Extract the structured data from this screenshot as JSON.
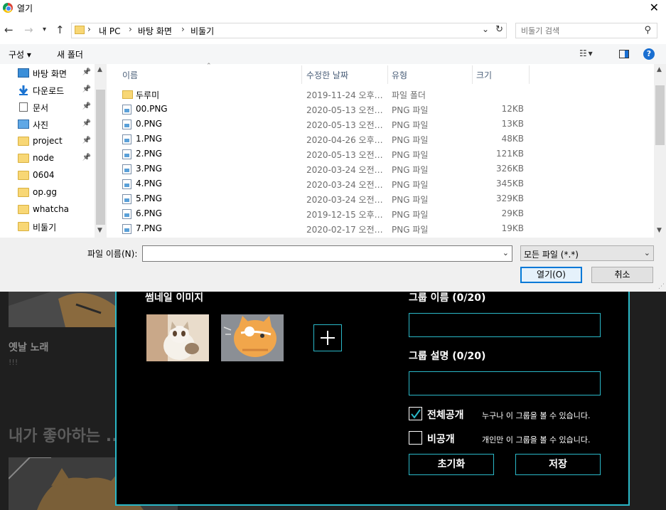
{
  "dialog": {
    "title": "열기",
    "address": {
      "root": "내 PC",
      "parts": [
        "바탕 화면",
        "비둘기"
      ]
    },
    "search_placeholder": "비둘기 검색",
    "toolbar": {
      "organize": "구성 ▾",
      "new_folder": "새 폴더",
      "help": "?"
    },
    "nav_items": [
      {
        "label": "바탕 화면",
        "icon": "desktop",
        "pinned": true
      },
      {
        "label": "다운로드",
        "icon": "download",
        "pinned": true
      },
      {
        "label": "문서",
        "icon": "document",
        "pinned": true
      },
      {
        "label": "사진",
        "icon": "picture",
        "pinned": true
      },
      {
        "label": "project",
        "icon": "folder",
        "pinned": true
      },
      {
        "label": "node",
        "icon": "folder",
        "pinned": true
      },
      {
        "label": "0604",
        "icon": "folder",
        "pinned": false
      },
      {
        "label": "op.gg",
        "icon": "folder",
        "pinned": false
      },
      {
        "label": "whatcha",
        "icon": "folder",
        "pinned": false
      },
      {
        "label": "비둘기",
        "icon": "folder",
        "pinned": false
      }
    ],
    "columns": {
      "name": "이름",
      "modified": "수정한 날짜",
      "type": "유형",
      "size": "크기"
    },
    "files": [
      {
        "name": "두루미",
        "date": "2019-11-24 오후 ...",
        "type": "파일 폴더",
        "size": "",
        "icon": "folder"
      },
      {
        "name": "00.PNG",
        "date": "2020-05-13 오전 ...",
        "type": "PNG 파일",
        "size": "12KB",
        "icon": "png"
      },
      {
        "name": "0.PNG",
        "date": "2020-05-13 오전 ...",
        "type": "PNG 파일",
        "size": "13KB",
        "icon": "png"
      },
      {
        "name": "1.PNG",
        "date": "2020-04-26 오후 ...",
        "type": "PNG 파일",
        "size": "48KB",
        "icon": "png"
      },
      {
        "name": "2.PNG",
        "date": "2020-05-13 오전 ...",
        "type": "PNG 파일",
        "size": "121KB",
        "icon": "png"
      },
      {
        "name": "3.PNG",
        "date": "2020-03-24 오전 ...",
        "type": "PNG 파일",
        "size": "326KB",
        "icon": "png"
      },
      {
        "name": "4.PNG",
        "date": "2020-03-24 오전 ...",
        "type": "PNG 파일",
        "size": "345KB",
        "icon": "png"
      },
      {
        "name": "5.PNG",
        "date": "2020-03-24 오전 ...",
        "type": "PNG 파일",
        "size": "329KB",
        "icon": "png"
      },
      {
        "name": "6.PNG",
        "date": "2019-12-15 오후 ...",
        "type": "PNG 파일",
        "size": "29KB",
        "icon": "png"
      },
      {
        "name": "7.PNG",
        "date": "2020-02-17 오전 ...",
        "type": "PNG 파일",
        "size": "19KB",
        "icon": "png"
      }
    ],
    "filename_label": "파일 이름(N):",
    "filename_value": "",
    "filetype": "모든 파일 (*.*)",
    "open_button": "열기(O)",
    "cancel_button": "취소"
  },
  "background": {
    "song_title": "옛날 노래",
    "song_sub": "!!!",
    "section_heading": "내가 좋아하는 ...",
    "modal": {
      "thumbnail_label": "썸네일 이미지",
      "group_name_label": "그룹 이름 (0/20)",
      "group_desc_label": "그룹 설명 (0/20)",
      "public_label": "전체공개",
      "public_desc": "누구나 이 그룹을 볼 수 있습니다.",
      "private_label": "비공개",
      "private_desc": "개인만 이 그룹을 볼 수 있습니다.",
      "reset_button": "초기화",
      "save_button": "저장",
      "public_checked": true,
      "private_checked": false
    }
  },
  "colors": {
    "accent": "#2ab8c8",
    "selected_button_border": "#0078d7"
  }
}
